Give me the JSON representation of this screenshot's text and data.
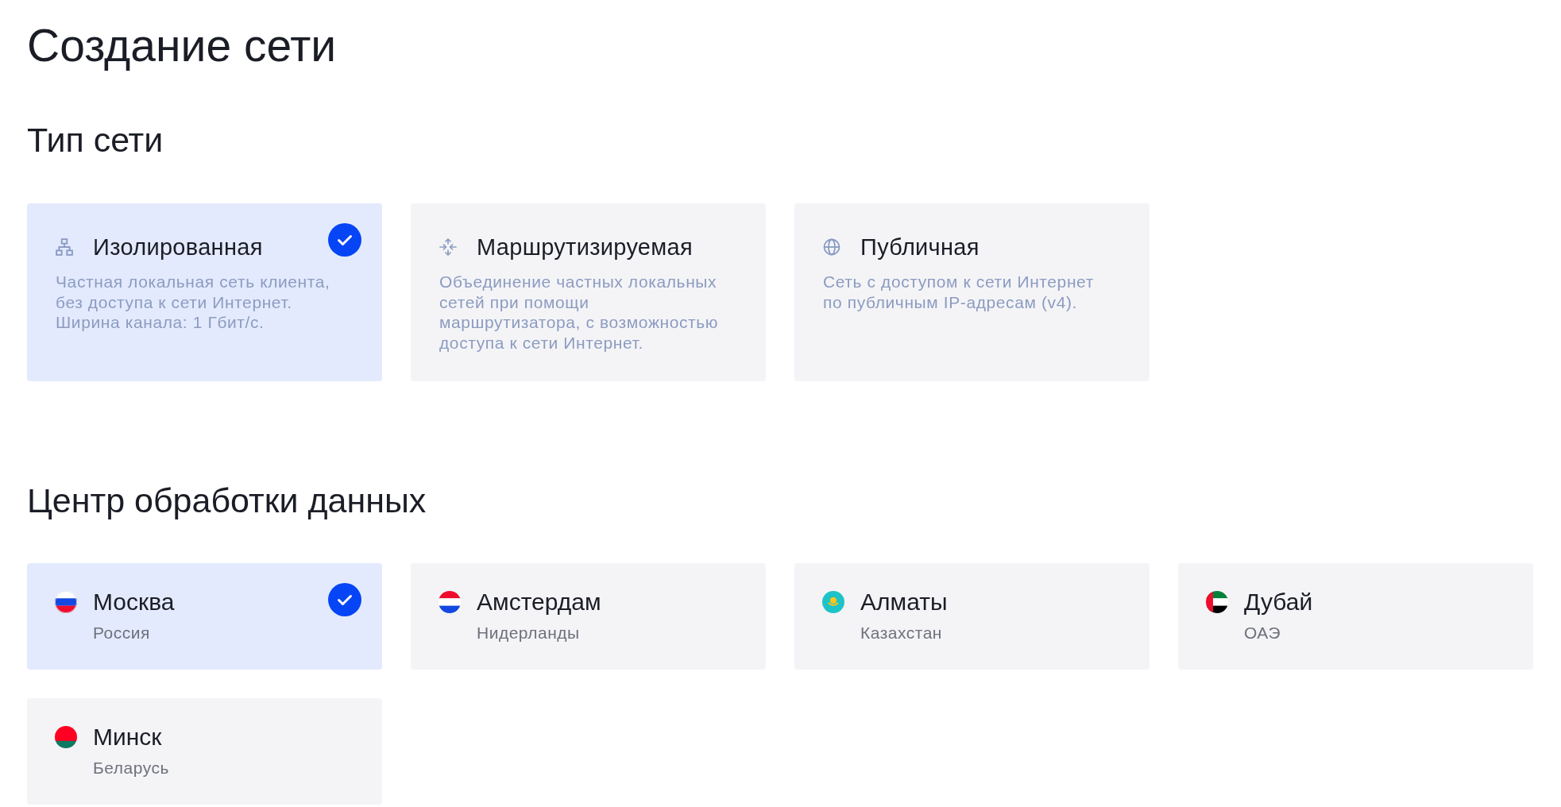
{
  "page_title": "Создание сети",
  "network_type": {
    "heading": "Тип сети",
    "options": [
      {
        "kind": "isolated",
        "title": "Изолированная",
        "description": "Частная локальная сеть клиента, без доступа к сети Интернет. Ширина канала: 1 Гбит/с.",
        "selected": true
      },
      {
        "kind": "routed",
        "title": "Маршрутизируемая",
        "description": "Объединение частных локальных сетей при помощи маршрутизатора, с возможностью доступа к сети Интернет.",
        "selected": false
      },
      {
        "kind": "public",
        "title": "Публичная",
        "description": "Сеть с доступом к сети Интернет по публичным IP-адресам (v4).",
        "selected": false
      }
    ]
  },
  "datacenter": {
    "heading": "Центр обработки данных",
    "locations": [
      {
        "kind": "russia",
        "city": "Москва",
        "country": "Россия",
        "selected": true
      },
      {
        "kind": "netherlands",
        "city": "Амстердам",
        "country": "Нидерланды",
        "selected": false
      },
      {
        "kind": "kazakhstan",
        "city": "Алматы",
        "country": "Казахстан",
        "selected": false
      },
      {
        "kind": "uae",
        "city": "Дубай",
        "country": "ОАЭ",
        "selected": false
      },
      {
        "kind": "belarus",
        "city": "Минск",
        "country": "Беларусь",
        "selected": false
      }
    ]
  }
}
